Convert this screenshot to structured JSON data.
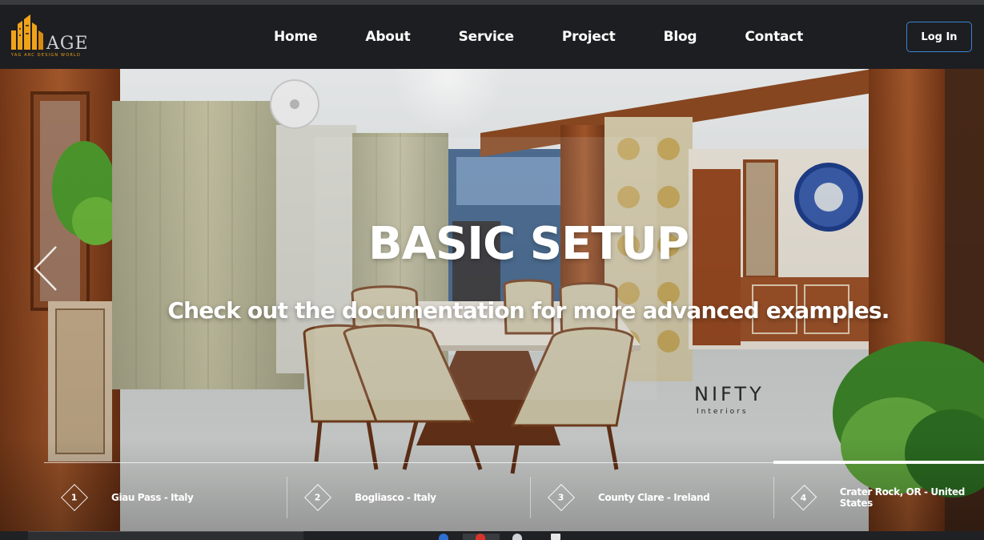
{
  "brand": {
    "logo_text": "MAGE",
    "logo_tagline": "YAG ARC DESIGN WORLD",
    "colors": {
      "logo_orange": "#f0a21a",
      "nav_bg": "#1d1e21",
      "login_border": "#3b83d6"
    }
  },
  "nav": {
    "items": [
      {
        "label": "Home"
      },
      {
        "label": "About"
      },
      {
        "label": "Service"
      },
      {
        "label": "Project"
      },
      {
        "label": "Blog"
      },
      {
        "label": "Contact"
      }
    ],
    "login_label": "Log In"
  },
  "hero": {
    "title": "BASIC SETUP",
    "subtitle": "Check out the documentation for more advanced examples.",
    "watermark_text": "NIFTY",
    "watermark_sub": "Interiors",
    "prev_icon": "chevron-left-icon"
  },
  "slides": [
    {
      "number": "1",
      "label": "Giau Pass - Italy"
    },
    {
      "number": "2",
      "label": "Bogliasco - Italy"
    },
    {
      "number": "3",
      "label": "County Clare - Ireland"
    },
    {
      "number": "4",
      "label": "Crater Rock, OR - United States"
    }
  ],
  "active_slide": 4
}
